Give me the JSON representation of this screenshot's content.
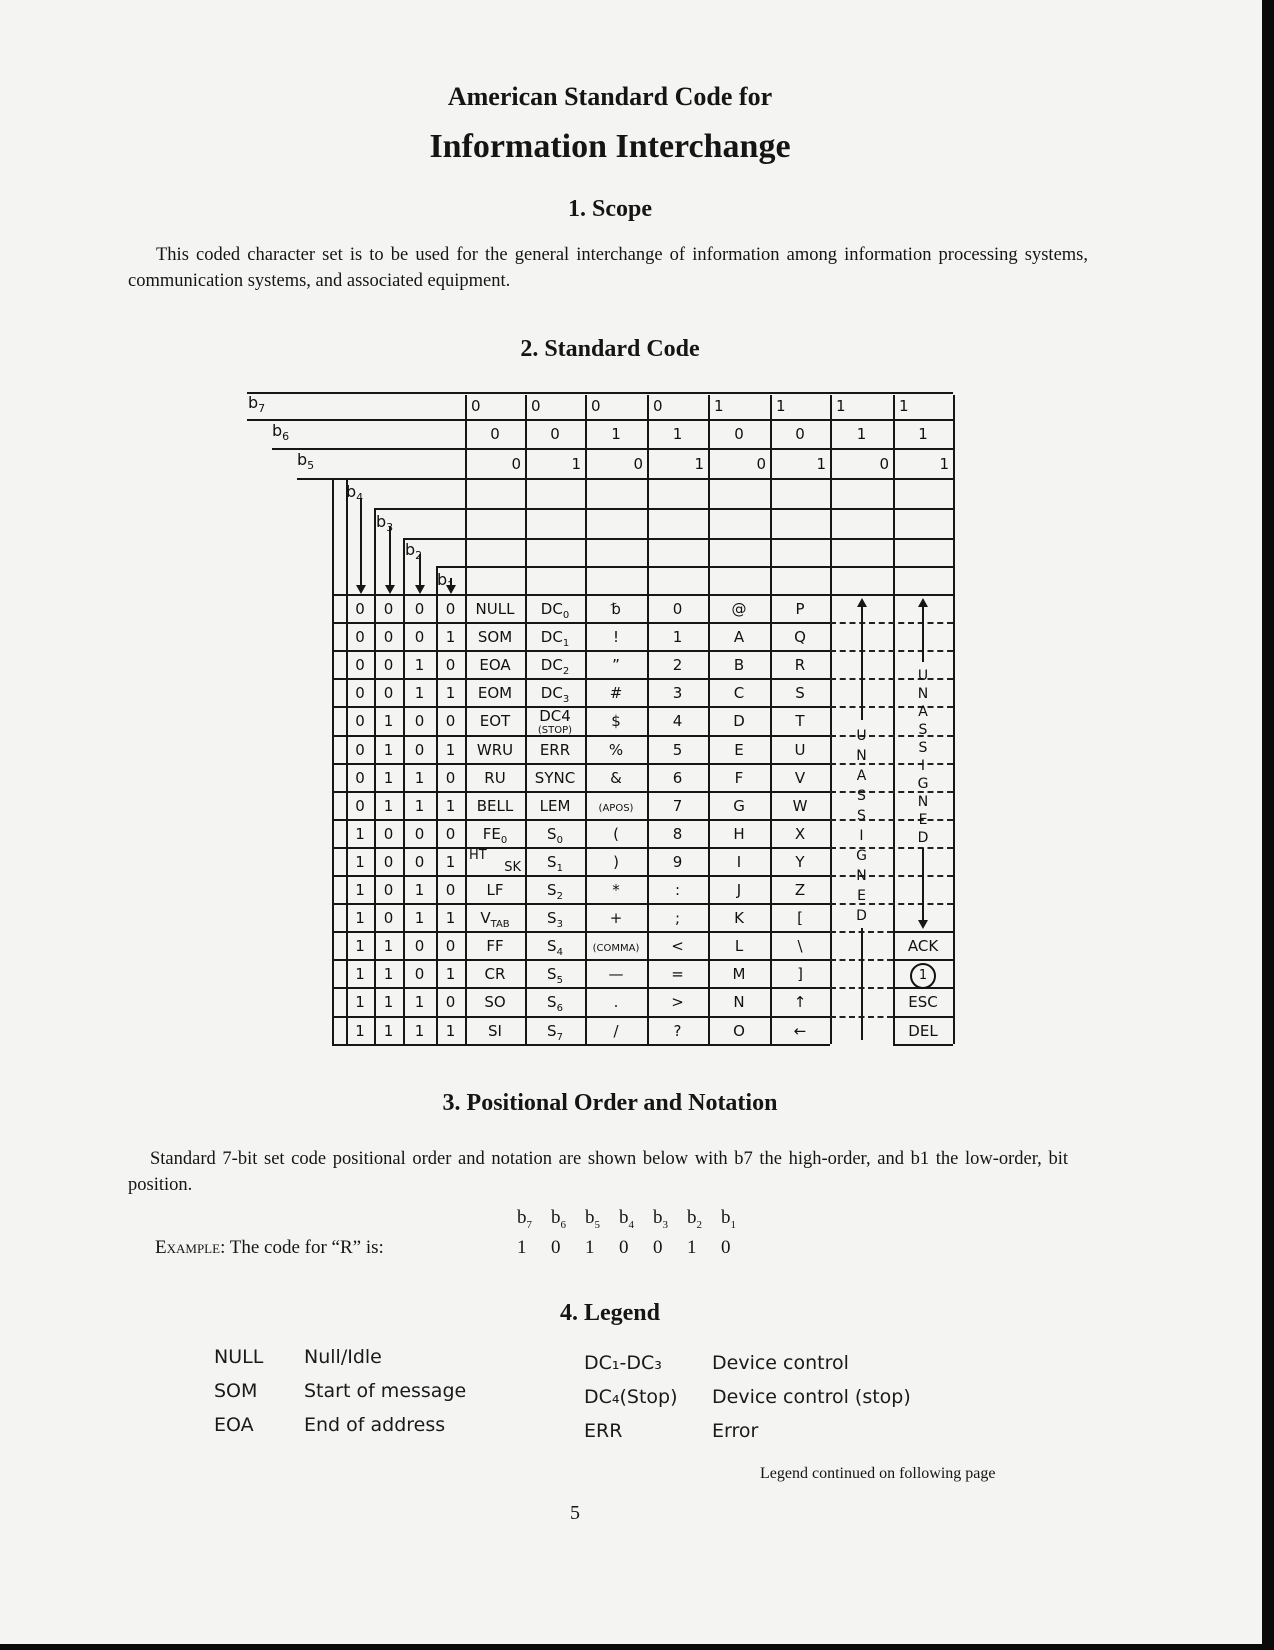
{
  "document": {
    "title_line1": "American Standard Code for",
    "title_line2": "Information Interchange",
    "page_number": "5"
  },
  "sections": {
    "scope": {
      "heading": "1. Scope",
      "text": "This coded character set is to be used for the general interchange of information among information processing systems, communication systems, and associated equipment."
    },
    "standard_code": {
      "heading": "2. Standard Code"
    },
    "positional": {
      "heading": "3. Positional Order and Notation",
      "text": "Standard 7-bit set code positional order and notation are shown below with b7 the high-order, and b1 the low-order, bit position.",
      "example_label_caps": "Example",
      "example_label_rest": ": The code for “R” is:",
      "bit_labels": [
        "b7",
        "b6",
        "b5",
        "b4",
        "b3",
        "b2",
        "b1"
      ],
      "bit_values": [
        "1",
        "0",
        "1",
        "0",
        "0",
        "1",
        "0"
      ]
    },
    "legend": {
      "heading": "4. Legend",
      "left": [
        {
          "code": "NULL",
          "meaning": "Null/Idle"
        },
        {
          "code": "SOM",
          "meaning": "Start of message"
        },
        {
          "code": "EOA",
          "meaning": "End of address"
        }
      ],
      "right": [
        {
          "code": "DC₁-DC₃",
          "meaning": "Device control"
        },
        {
          "code": "DC₄(Stop)",
          "meaning": "Device control (stop)"
        },
        {
          "code": "ERR",
          "meaning": "Error"
        }
      ],
      "continued": "Legend continued on following page"
    }
  },
  "code_table": {
    "header_bit_labels": {
      "b7": "b7",
      "b6": "b6",
      "b5": "b5",
      "b4": "b4",
      "b3": "b3",
      "b2": "b2",
      "b1": "b1"
    },
    "column_bits": {
      "b7": [
        "0",
        "0",
        "0",
        "0",
        "1",
        "1",
        "1",
        "1"
      ],
      "b6": [
        "0",
        "0",
        "1",
        "1",
        "0",
        "0",
        "1",
        "1"
      ],
      "b5": [
        "0",
        "1",
        "0",
        "1",
        "0",
        "1",
        "0",
        "1"
      ]
    },
    "rows": [
      {
        "bits": [
          "0",
          "0",
          "0",
          "0"
        ],
        "cols": [
          "NULL",
          "DC0",
          "␢",
          "0",
          "@",
          "P"
        ]
      },
      {
        "bits": [
          "0",
          "0",
          "0",
          "1"
        ],
        "cols": [
          "SOM",
          "DC1",
          "!",
          "1",
          "A",
          "Q"
        ]
      },
      {
        "bits": [
          "0",
          "0",
          "1",
          "0"
        ],
        "cols": [
          "EOA",
          "DC2",
          "”",
          "2",
          "B",
          "R"
        ]
      },
      {
        "bits": [
          "0",
          "0",
          "1",
          "1"
        ],
        "cols": [
          "EOM",
          "DC3",
          "#",
          "3",
          "C",
          "S"
        ]
      },
      {
        "bits": [
          "0",
          "1",
          "0",
          "0"
        ],
        "cols": [
          "EOT",
          "DC4 (STOP)",
          "$",
          "4",
          "D",
          "T"
        ]
      },
      {
        "bits": [
          "0",
          "1",
          "0",
          "1"
        ],
        "cols": [
          "WRU",
          "ERR",
          "%",
          "5",
          "E",
          "U"
        ]
      },
      {
        "bits": [
          "0",
          "1",
          "1",
          "0"
        ],
        "cols": [
          "RU",
          "SYNC",
          "&",
          "6",
          "F",
          "V"
        ]
      },
      {
        "bits": [
          "0",
          "1",
          "1",
          "1"
        ],
        "cols": [
          "BELL",
          "LEM",
          "' (APOS)",
          "7",
          "G",
          "W"
        ]
      },
      {
        "bits": [
          "1",
          "0",
          "0",
          "0"
        ],
        "cols": [
          "FE0",
          "S0",
          "(",
          "8",
          "H",
          "X"
        ]
      },
      {
        "bits": [
          "1",
          "0",
          "0",
          "1"
        ],
        "cols": [
          "HT/SK",
          "S1",
          ")",
          "9",
          "I",
          "Y"
        ]
      },
      {
        "bits": [
          "1",
          "0",
          "1",
          "0"
        ],
        "cols": [
          "LF",
          "S2",
          "*",
          ":",
          "J",
          "Z"
        ]
      },
      {
        "bits": [
          "1",
          "0",
          "1",
          "1"
        ],
        "cols": [
          "VTAB",
          "S3",
          "+",
          ";",
          "K",
          "["
        ]
      },
      {
        "bits": [
          "1",
          "1",
          "0",
          "0"
        ],
        "cols": [
          "FF",
          "S4",
          ", (COMMA)",
          "<",
          "L",
          "\\"
        ]
      },
      {
        "bits": [
          "1",
          "1",
          "0",
          "1"
        ],
        "cols": [
          "CR",
          "S5",
          "—",
          "=",
          "M",
          "]"
        ]
      },
      {
        "bits": [
          "1",
          "1",
          "1",
          "0"
        ],
        "cols": [
          "SO",
          "S6",
          ".",
          ">",
          "N",
          "↑"
        ]
      },
      {
        "bits": [
          "1",
          "1",
          "1",
          "1"
        ],
        "cols": [
          "SI",
          "S7",
          "/",
          "?",
          "O",
          "←"
        ]
      }
    ],
    "unassigned_label": "UNASSIGNED",
    "last_column_bottom": [
      "ACK",
      "1",
      "ESC",
      "DEL"
    ]
  }
}
